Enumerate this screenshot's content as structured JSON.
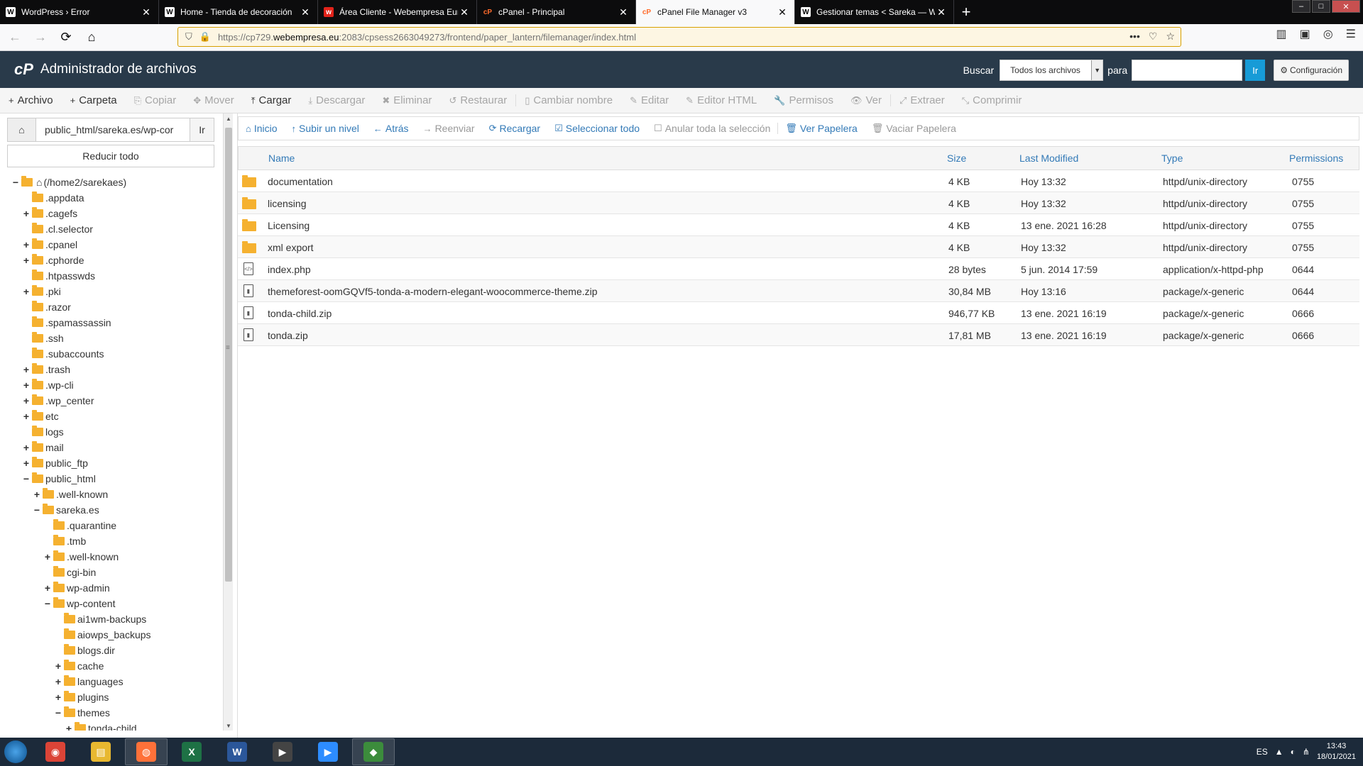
{
  "browser": {
    "tabs": [
      {
        "label": "WordPress › Error",
        "favicon": "wp",
        "active": false
      },
      {
        "label": "Home - Tienda de decoración",
        "favicon": "wp",
        "active": false
      },
      {
        "label": "Área Cliente - Webempresa Eur",
        "favicon": "we",
        "active": false
      },
      {
        "label": "cPanel - Principal",
        "favicon": "cp",
        "active": false
      },
      {
        "label": "cPanel File Manager v3",
        "favicon": "cp",
        "active": true
      },
      {
        "label": "Gestionar temas < Sareka — W",
        "favicon": "wp",
        "active": false
      }
    ],
    "url_prefix": "https://cp729.",
    "url_host": "webempresa.eu",
    "url_rest": ":2083/cpsess2663049273/frontend/paper_lantern/filemanager/index.html"
  },
  "header": {
    "logo": "cP",
    "title": "Administrador de archivos",
    "search_label": "Buscar",
    "search_scope": "Todos los archivos",
    "para_label": "para",
    "search_go": "Ir",
    "settings_label": "Configuración"
  },
  "toolbar": {
    "items": [
      {
        "label": "Archivo",
        "icon": "+",
        "enabled": true
      },
      {
        "label": "Carpeta",
        "icon": "+",
        "enabled": true
      },
      {
        "label": "Copiar",
        "icon": "⎘",
        "enabled": false
      },
      {
        "label": "Mover",
        "icon": "✥",
        "enabled": false
      },
      {
        "label": "Cargar",
        "icon": "⤒",
        "enabled": true
      },
      {
        "label": "Descargar",
        "icon": "⤓",
        "enabled": false
      },
      {
        "label": "Eliminar",
        "icon": "✖",
        "enabled": false
      },
      {
        "label": "Restaurar",
        "icon": "↺",
        "enabled": false
      },
      {
        "label": "Cambiar nombre",
        "icon": "▯",
        "enabled": false
      },
      {
        "label": "Editar",
        "icon": "✎",
        "enabled": false
      },
      {
        "label": "Editor HTML",
        "icon": "✎",
        "enabled": false
      },
      {
        "label": "Permisos",
        "icon": "🔧",
        "enabled": false
      },
      {
        "label": "Ver",
        "icon": "👁",
        "enabled": false
      },
      {
        "label": "Extraer",
        "icon": "⤢",
        "enabled": false
      },
      {
        "label": "Comprimir",
        "icon": "⤡",
        "enabled": false
      }
    ]
  },
  "left": {
    "path_value": "public_html/sareka.es/wp-cor",
    "path_go": "Ir",
    "collapse_label": "Reducir todo",
    "tree": [
      {
        "label": "(/home2/sarekaes)",
        "depth": 0,
        "tog": "−",
        "home": true
      },
      {
        "label": ".appdata",
        "depth": 1,
        "tog": ""
      },
      {
        "label": ".cagefs",
        "depth": 1,
        "tog": "+"
      },
      {
        "label": ".cl.selector",
        "depth": 1,
        "tog": ""
      },
      {
        "label": ".cpanel",
        "depth": 1,
        "tog": "+"
      },
      {
        "label": ".cphorde",
        "depth": 1,
        "tog": "+"
      },
      {
        "label": ".htpasswds",
        "depth": 1,
        "tog": ""
      },
      {
        "label": ".pki",
        "depth": 1,
        "tog": "+"
      },
      {
        "label": ".razor",
        "depth": 1,
        "tog": ""
      },
      {
        "label": ".spamassassin",
        "depth": 1,
        "tog": ""
      },
      {
        "label": ".ssh",
        "depth": 1,
        "tog": ""
      },
      {
        "label": ".subaccounts",
        "depth": 1,
        "tog": ""
      },
      {
        "label": ".trash",
        "depth": 1,
        "tog": "+"
      },
      {
        "label": ".wp-cli",
        "depth": 1,
        "tog": "+"
      },
      {
        "label": ".wp_center",
        "depth": 1,
        "tog": "+"
      },
      {
        "label": "etc",
        "depth": 1,
        "tog": "+"
      },
      {
        "label": "logs",
        "depth": 1,
        "tog": ""
      },
      {
        "label": "mail",
        "depth": 1,
        "tog": "+"
      },
      {
        "label": "public_ftp",
        "depth": 1,
        "tog": "+"
      },
      {
        "label": "public_html",
        "depth": 1,
        "tog": "−"
      },
      {
        "label": ".well-known",
        "depth": 2,
        "tog": "+"
      },
      {
        "label": "sareka.es",
        "depth": 2,
        "tog": "−"
      },
      {
        "label": ".quarantine",
        "depth": 3,
        "tog": ""
      },
      {
        "label": ".tmb",
        "depth": 3,
        "tog": ""
      },
      {
        "label": ".well-known",
        "depth": 3,
        "tog": "+"
      },
      {
        "label": "cgi-bin",
        "depth": 3,
        "tog": ""
      },
      {
        "label": "wp-admin",
        "depth": 3,
        "tog": "+"
      },
      {
        "label": "wp-content",
        "depth": 3,
        "tog": "−"
      },
      {
        "label": "ai1wm-backups",
        "depth": 4,
        "tog": ""
      },
      {
        "label": "aiowps_backups",
        "depth": 4,
        "tog": ""
      },
      {
        "label": "blogs.dir",
        "depth": 4,
        "tog": ""
      },
      {
        "label": "cache",
        "depth": 4,
        "tog": "+"
      },
      {
        "label": "languages",
        "depth": 4,
        "tog": "+"
      },
      {
        "label": "plugins",
        "depth": 4,
        "tog": "+"
      },
      {
        "label": "themes",
        "depth": 4,
        "tog": "−"
      },
      {
        "label": "tonda-child",
        "depth": 5,
        "tog": "+"
      }
    ]
  },
  "subtoolbar": {
    "items": [
      {
        "label": "Inicio",
        "icon": "⌂",
        "enabled": true
      },
      {
        "label": "Subir un nivel",
        "icon": "↑",
        "enabled": true
      },
      {
        "label": "Atrás",
        "icon": "←",
        "enabled": true
      },
      {
        "label": "Reenviar",
        "icon": "→",
        "enabled": false
      },
      {
        "label": "Recargar",
        "icon": "⟳",
        "enabled": true
      },
      {
        "label": "Seleccionar todo",
        "icon": "☑",
        "enabled": true
      },
      {
        "label": "Anular toda la selección",
        "icon": "☐",
        "enabled": false
      },
      {
        "label": "Ver Papelera",
        "icon": "🗑",
        "enabled": true
      },
      {
        "label": "Vaciar Papelera",
        "icon": "🗑",
        "enabled": false
      }
    ]
  },
  "table": {
    "headers": {
      "name": "Name",
      "size": "Size",
      "modified": "Last Modified",
      "type": "Type",
      "perms": "Permissions"
    },
    "rows": [
      {
        "name": "documentation",
        "size": "4 KB",
        "modified": "Hoy 13:32",
        "type": "httpd/unix-directory",
        "perms": "0755",
        "kind": "dir"
      },
      {
        "name": "licensing",
        "size": "4 KB",
        "modified": "Hoy 13:32",
        "type": "httpd/unix-directory",
        "perms": "0755",
        "kind": "dir"
      },
      {
        "name": "Licensing",
        "size": "4 KB",
        "modified": "13 ene. 2021 16:28",
        "type": "httpd/unix-directory",
        "perms": "0755",
        "kind": "dir"
      },
      {
        "name": "xml export",
        "size": "4 KB",
        "modified": "Hoy 13:32",
        "type": "httpd/unix-directory",
        "perms": "0755",
        "kind": "dir"
      },
      {
        "name": "index.php",
        "size": "28 bytes",
        "modified": "5 jun. 2014 17:59",
        "type": "application/x-httpd-php",
        "perms": "0644",
        "kind": "php"
      },
      {
        "name": "themeforest-oomGQVf5-tonda-a-modern-elegant-woocommerce-theme.zip",
        "size": "30,84 MB",
        "modified": "Hoy 13:16",
        "type": "package/x-generic",
        "perms": "0644",
        "kind": "zip"
      },
      {
        "name": "tonda-child.zip",
        "size": "946,77 KB",
        "modified": "13 ene. 2021 16:19",
        "type": "package/x-generic",
        "perms": "0666",
        "kind": "zip"
      },
      {
        "name": "tonda.zip",
        "size": "17,81 MB",
        "modified": "13 ene. 2021 16:19",
        "type": "package/x-generic",
        "perms": "0666",
        "kind": "zip"
      }
    ]
  },
  "taskbar": {
    "apps": [
      {
        "name": "chrome",
        "color": "#db4437",
        "glyph": "◉",
        "open": false
      },
      {
        "name": "explorer",
        "color": "#e8b830",
        "glyph": "▤",
        "open": false
      },
      {
        "name": "firefox",
        "color": "#ff7139",
        "glyph": "◍",
        "open": true
      },
      {
        "name": "excel",
        "color": "#1e7145",
        "glyph": "X",
        "open": false
      },
      {
        "name": "word",
        "color": "#2b579a",
        "glyph": "W",
        "open": false
      },
      {
        "name": "terminal",
        "color": "#444444",
        "glyph": "▶",
        "open": false
      },
      {
        "name": "zoom",
        "color": "#2d8cff",
        "glyph": "▶",
        "open": false
      },
      {
        "name": "app",
        "color": "#3c8c3c",
        "glyph": "◆",
        "open": true
      }
    ],
    "lang": "ES",
    "time": "13:43",
    "date": "18/01/2021"
  }
}
